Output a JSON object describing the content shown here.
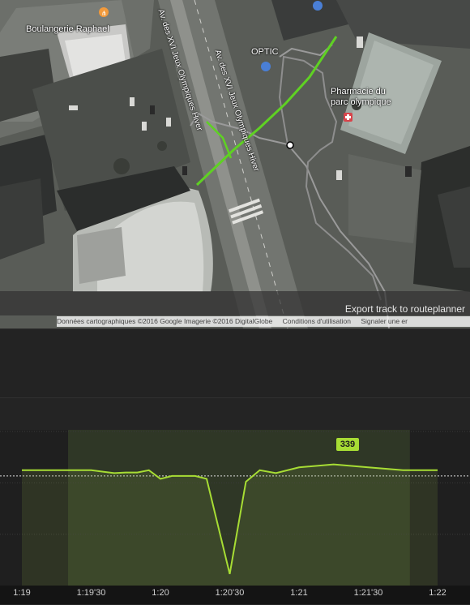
{
  "map": {
    "pois": {
      "boulangerie": "Boulangerie Raphael",
      "optic": "OPTIC",
      "pharmacie_line1": "Pharmacie du",
      "pharmacie_line2": "parc olympique"
    },
    "streets": {
      "west": "Av. des XVI Jeux Olympiques Hiver",
      "east": "Av. des XVI Jeux Olympiques Hiver"
    },
    "export_label": "Export track to routeplanner",
    "attribution": {
      "data": "Données cartographiques ©2016 Google Imagerie ©2016 DigitalGlobe",
      "terms": "Conditions d'utilisation",
      "report": "Signaler une er"
    },
    "icons": {
      "boulangerie": "fork-knife-icon",
      "optic": "shopping-bag-icon",
      "pharmacie": "pharmacy-cross-icon"
    },
    "colors": {
      "selected_track": "#5fd123",
      "track": "#9a9a9a"
    }
  },
  "chart_data": {
    "type": "line",
    "x": [
      "1:19",
      "1:19:15",
      "1:19:30",
      "1:19:40",
      "1:19:45",
      "1:19:50",
      "1:19:55",
      "1:20",
      "1:20:05",
      "1:20:15",
      "1:20:20",
      "1:20:30",
      "1:20:37",
      "1:20:43",
      "1:20:50",
      "1:21",
      "1:21:15",
      "1:21:30",
      "1:21:45",
      "1:22"
    ],
    "xticks": [
      "1:19",
      "1:19'30",
      "1:20",
      "1:20'30",
      "1:21",
      "1:21'30",
      "1:22"
    ],
    "series": [
      {
        "values": [
          338,
          338,
          338,
          337.5,
          337.6,
          337.6,
          338,
          336.5,
          337,
          337,
          336.5,
          320,
          336,
          338,
          337.5,
          338.5,
          339,
          338.5,
          338,
          338
        ]
      }
    ],
    "highlight_range": [
      "1:19:20",
      "1:21:48"
    ],
    "peak_label": "339",
    "reference_line": 337
  }
}
